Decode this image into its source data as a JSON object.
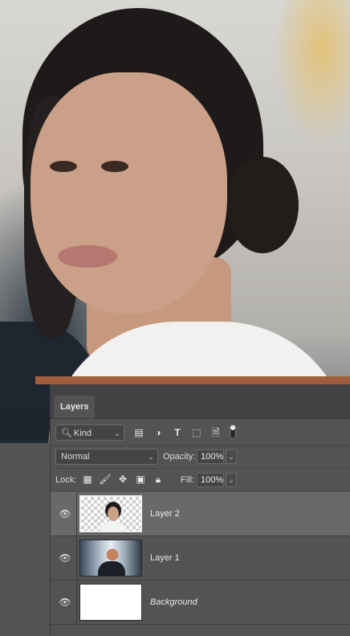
{
  "layers_panel": {
    "tab_label": "Layers",
    "filter": {
      "kind_label": "Kind",
      "icons": [
        "pixel-filter-icon",
        "adjustment-filter-icon",
        "type-filter-icon",
        "shape-filter-icon",
        "smart-object-filter-icon",
        "filter-toggle"
      ]
    },
    "blend_mode": "Normal",
    "opacity_label": "Opacity:",
    "opacity_value": "100%",
    "lock_label": "Lock:",
    "fill_label": "Fill:",
    "fill_value": "100%",
    "layers": [
      {
        "name": "Layer 2",
        "selected": true,
        "visible": true,
        "thumbnail": "woman-portrait-transparent"
      },
      {
        "name": "Layer 1",
        "selected": false,
        "visible": true,
        "thumbnail": "man-portrait-photo"
      },
      {
        "name": "Background",
        "selected": false,
        "visible": true,
        "thumbnail": "white-fill",
        "italic": true
      }
    ]
  },
  "colors": {
    "panel_bg": "#535353",
    "selected_layer_bg": "#696969",
    "tabbar_bg": "#424242"
  }
}
